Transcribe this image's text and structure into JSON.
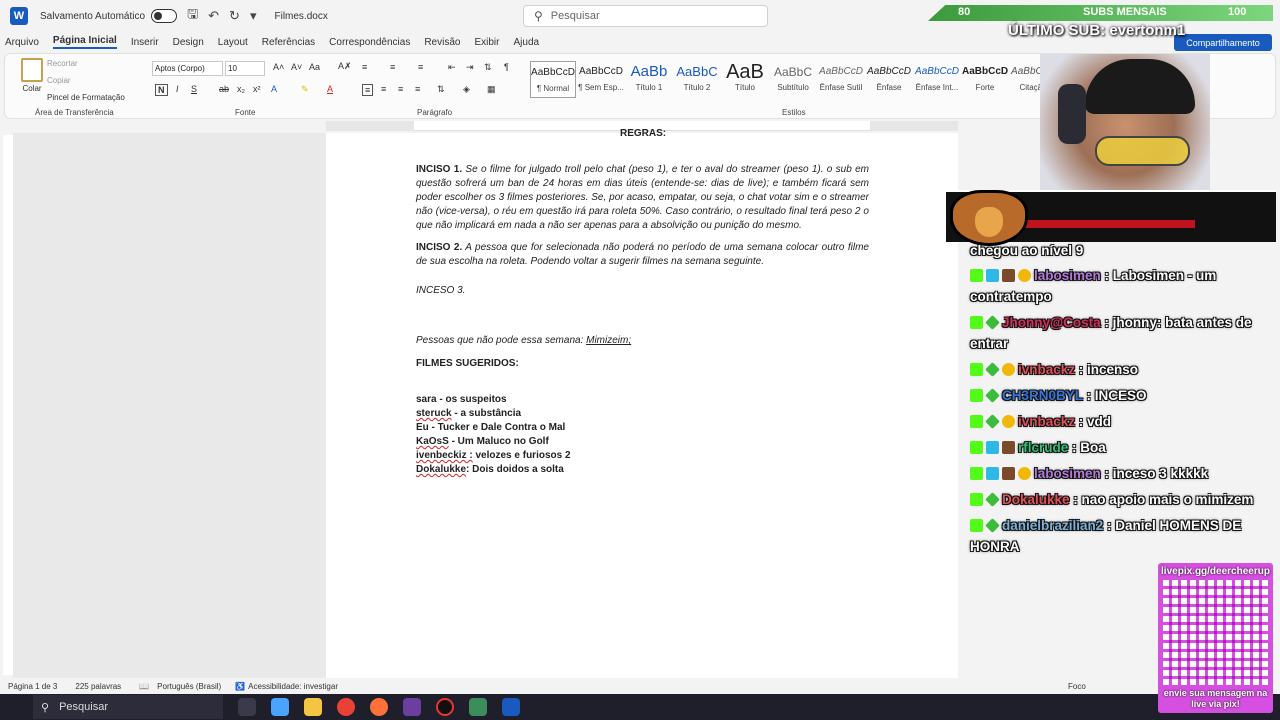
{
  "titlebar": {
    "autosave_label": "Salvamento Automático",
    "filename": "Filmes.docx",
    "search_placeholder": "Pesquisar"
  },
  "menu": {
    "tabs": [
      "Arquivo",
      "Página Inicial",
      "Inserir",
      "Design",
      "Layout",
      "Referências",
      "Correspondências",
      "Revisão",
      "Exibir",
      "Ajuda"
    ],
    "share_label": "Compartilhamento"
  },
  "ribbon": {
    "clipboard": {
      "paste": "Colar",
      "cut": "Recortar",
      "copy": "Copiar",
      "format_painter": "Pincel de Formatação",
      "group": "Área de Transferência"
    },
    "font": {
      "family": "Aptos (Corpo)",
      "size": "10",
      "group": "Fonte"
    },
    "paragraph": {
      "group": "Parágrafo"
    },
    "styles": {
      "group": "Estilos",
      "items": [
        {
          "preview": "AaBbCcD",
          "name": "¶ Normal"
        },
        {
          "preview": "AaBbCcD",
          "name": "¶ Sem Esp..."
        },
        {
          "preview": "AaBb",
          "name": "Título 1"
        },
        {
          "preview": "AaBbC",
          "name": "Título 2"
        },
        {
          "preview": "AaB",
          "name": "Título"
        },
        {
          "preview": "AaBbC",
          "name": "Subtítulo"
        },
        {
          "preview": "AaBbCcD",
          "name": "Ênfase Sutil"
        },
        {
          "preview": "AaBbCcD",
          "name": "Ênfase"
        },
        {
          "preview": "AaBbCcD",
          "name": "Ênfase Int..."
        },
        {
          "preview": "AaBbCcD",
          "name": "Forte"
        },
        {
          "preview": "AaBbCcD",
          "name": "Citação"
        }
      ]
    }
  },
  "document": {
    "top_cut": "REGRAS:",
    "inciso1_label": "INCISO 1.",
    "inciso1_text": " Se o filme for julgado troll pelo chat (peso 1), e ter o aval do streamer (peso 1). o sub em questão sofrerá um ban de 24 horas em dias úteis (entende-se: dias de live); e também ficará sem poder escolher os 3 filmes posteriores. Se, por acaso, empatar, ou seja, o chat votar sim e o streamer não (vice-versa), o réu em questão irá para roleta 50%. Caso contrário, o resultado final terá peso 2 o que não implicará em nada a não ser apenas para a absolvição ou punição do mesmo.",
    "inciso2_label": "INCISO 2.",
    "inciso2_text": " A pessoa que for selecionada não poderá no período de uma semana colocar outro filme de sua escolha na roleta. Podendo voltar a sugerir filmes na semana seguinte.",
    "inceso3": "INCESO 3.",
    "absent_label": "Pessoas que não pode essa semana: ",
    "absent_name": "Mimizeim;",
    "suggested_title": "FILMES SUGERIDOS:",
    "suggestions": [
      {
        "user": "sara",
        "film": " - os suspeitos"
      },
      {
        "user": "steruck",
        "film": " - a substância"
      },
      {
        "user": "Eu",
        "film": " - Tucker e Dale Contra o Mal"
      },
      {
        "user": "KaOsS",
        "film": " - Um Maluco no Golf"
      },
      {
        "user": "ivenbeckiz :",
        "film": " velozes e furiosos 2"
      },
      {
        "user": "Dokalukke",
        "film": ": Dois doidos a solta"
      }
    ]
  },
  "statusbar": {
    "page": "Página 1 de 3",
    "words": "225 palavras",
    "language": "Português (Brasil)",
    "accessibility": "Acessibilidade: investigar",
    "focus": "Foco"
  },
  "taskbar": {
    "search": "Pesquisar"
  },
  "overlay": {
    "subs_low": "80",
    "subs_title": "SUBS MENSAIS",
    "subs_high": "100",
    "last_sub": "ÚLTIMO SUB: evertonm1",
    "chat": [
      {
        "user": "",
        "text": "chegou ao nível 9",
        "user_color": "#ffffff"
      },
      {
        "user": "labosimen",
        "text": " : Labosimen - um contratempo",
        "user_color": "#b07ad8"
      },
      {
        "user": "Jhonny@Costa",
        "text": " : jhonny: bata antes de entrar",
        "user_color": "#d6305a"
      },
      {
        "user": "ivnbackz",
        "text": " : incenso",
        "user_color": "#e0505a"
      },
      {
        "user": "CH3RN0BYL",
        "text": " : INCESO",
        "user_color": "#3b74d6"
      },
      {
        "user": "ivnbackz",
        "text": " : vdd",
        "user_color": "#e0505a"
      },
      {
        "user": "rflcrude",
        "text": " : Boa",
        "user_color": "#36c27a"
      },
      {
        "user": "labosimen",
        "text": " : inceso 3 kkkkk",
        "user_color": "#b07ad8"
      },
      {
        "user": "Dokalukke",
        "text": " : nao apoio mais o mimizem",
        "user_color": "#e0505a"
      },
      {
        "user": "danielbrazilian2",
        "text": " : Daniel HOMENS DE HONRA",
        "user_color": "#7cb0d8"
      }
    ],
    "qr_url": "livepix.gg/deercheerup",
    "qr_caption": "envie sua mensagem na live via pix!"
  },
  "colors": {
    "word_blue": "#185abd",
    "doc_red": "#d1232a",
    "doc_green": "#4caf50"
  }
}
